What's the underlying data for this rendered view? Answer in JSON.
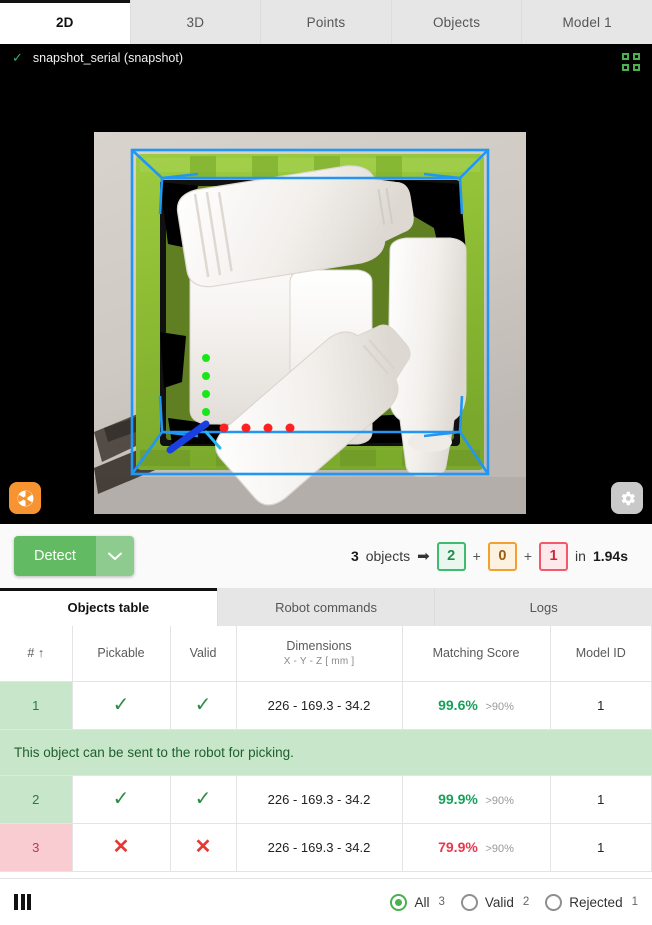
{
  "top_tabs": [
    {
      "label": "2D",
      "active": true
    },
    {
      "label": "3D",
      "active": false
    },
    {
      "label": "Points",
      "active": false
    },
    {
      "label": "Objects",
      "active": false
    },
    {
      "label": "Model 1",
      "active": false
    }
  ],
  "viewer": {
    "status_icon": "check-icon",
    "title": "snapshot_serial (snapshot)",
    "fullscreen_icon": "fullscreen-icon",
    "camera_button_icon": "camera-aperture-icon",
    "settings_button_icon": "gear-icon",
    "overlay": {
      "bin_box_color": "#2196f3",
      "axis_x_color": "#ff2020",
      "axis_y_color": "#19e619",
      "axis_z_color": "#1a3fe0",
      "crate_color": "#8bbf35"
    }
  },
  "action_bar": {
    "detect_label": "Detect",
    "detect_caret_icon": "chevron-down-icon",
    "summary": {
      "total": "3",
      "objects_word": "objects",
      "arrow": "➡",
      "valid_count": "2",
      "warn_count": "0",
      "rejected_count": "1",
      "plus": "+",
      "in_word": "in",
      "duration": "1.94s"
    },
    "colors": {
      "detect_green": "#62bb62",
      "badge_green": "#3dbb6e",
      "badge_orange": "#f3a030",
      "badge_red": "#f2596a"
    }
  },
  "sub_tabs": [
    {
      "label": "Objects table",
      "active": true
    },
    {
      "label": "Robot commands",
      "active": false
    },
    {
      "label": "Logs",
      "active": false
    }
  ],
  "table": {
    "headers": {
      "num": "#",
      "num_sort_icon": "↑",
      "pickable": "Pickable",
      "valid": "Valid",
      "dimensions": "Dimensions",
      "dimensions_sub": "X - Y - Z [ mm ]",
      "matching_score": "Matching Score",
      "model_id": "Model ID"
    },
    "rows": [
      {
        "num": "1",
        "state": "ok",
        "pickable": "✓",
        "valid": "✓",
        "dimensions": "226 - 169.3 - 34.2",
        "score": "99.6%",
        "score_state": "good",
        "threshold": ">90%",
        "model_id": "1"
      },
      {
        "num": "2",
        "state": "ok",
        "pickable": "✓",
        "valid": "✓",
        "dimensions": "226 - 169.3 - 34.2",
        "score": "99.9%",
        "score_state": "good",
        "threshold": ">90%",
        "model_id": "1"
      },
      {
        "num": "3",
        "state": "bad",
        "pickable": "✕",
        "valid": "✕",
        "dimensions": "226 - 169.3 - 34.2",
        "score": "79.9%",
        "score_state": "bad",
        "threshold": ">90%",
        "model_id": "1"
      }
    ],
    "expanded_note": "This object can be sent to the robot for picking."
  },
  "footer": {
    "columns_icon": "columns-icon",
    "filters": [
      {
        "label": "All",
        "count": "3",
        "selected": true
      },
      {
        "label": "Valid",
        "count": "2",
        "selected": false
      },
      {
        "label": "Rejected",
        "count": "1",
        "selected": false
      }
    ]
  }
}
